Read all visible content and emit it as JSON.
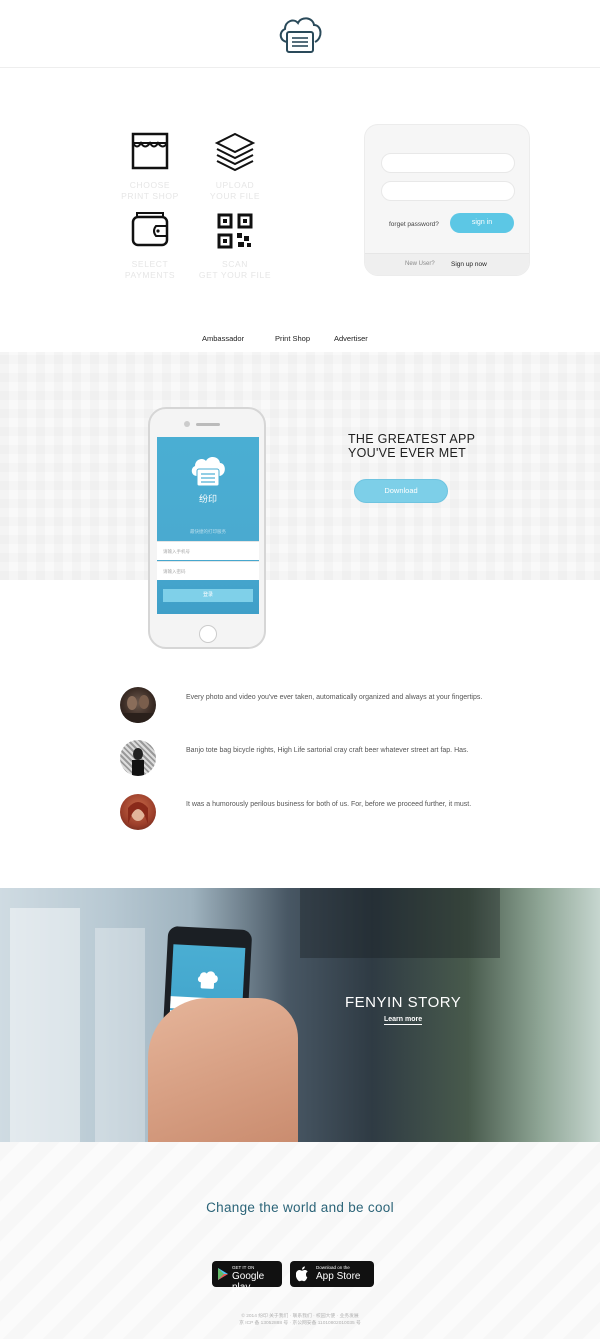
{
  "header": {
    "logo_icon": "cloud-printer-icon"
  },
  "features": [
    {
      "icon": "shop-icon",
      "line1": "CHOOSE",
      "line2": "PRINT SHOP"
    },
    {
      "icon": "layers-icon",
      "line1": "UPLOAD",
      "line2": "YOUR FILE"
    },
    {
      "icon": "wallet-icon",
      "line1": "SELECT",
      "line2": "PAYMENTS"
    },
    {
      "icon": "qr-code-icon",
      "line1": "SCAN",
      "line2": "GET YOUR FILE"
    }
  ],
  "login": {
    "forgot": "forget password?",
    "signin": "sign in",
    "new_user": "New User?",
    "signup": "Sign up now"
  },
  "nav": {
    "ambassador": "Ambassador",
    "print_shop": "Print Shop",
    "advertiser": "Advertiser"
  },
  "app_promo": {
    "line1": "THE GREATEST APP",
    "line2": "YOU'VE EVER MET",
    "download": "Download",
    "phone": {
      "app_name": "纷印",
      "slogan": "最快捷的打印服务",
      "field1": "请输入手机号",
      "field2": "请输入密码",
      "button": "登录"
    }
  },
  "testimonials": [
    {
      "text": "Every photo and video you've ever taken, automatically organized and always at your fingertips."
    },
    {
      "text": "Banjo tote bag bicycle rights, High Life sartorial cray craft beer whatever street art fap. Has."
    },
    {
      "text": "It was a humorously perilous business for both of us. For, before we proceed further, it must."
    }
  ],
  "story": {
    "title": "FENYIN STORY",
    "link": "Learn more"
  },
  "bottom": {
    "motto": "Change the world and be cool",
    "google_small": "GET IT ON",
    "google_big": "Google play",
    "apple_small": "Download on the",
    "apple_big": "App Store",
    "footer_line1": "© 2014 纷印 关于我们 · 联系我们 · 校园大使 · 业务发展",
    "footer_line2": "京 ICP 备 13052888 号 · 京公网安备 11010802010035 号"
  }
}
